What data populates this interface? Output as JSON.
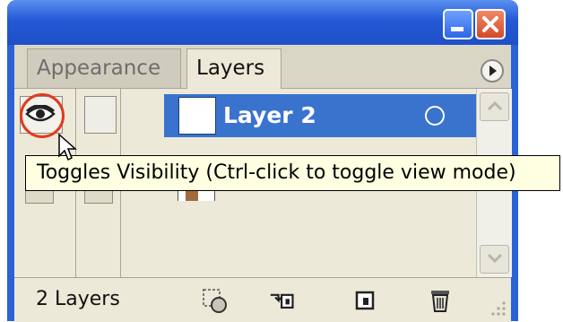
{
  "tabs": [
    {
      "label": "Appearance",
      "active": false
    },
    {
      "label": "Layers",
      "active": true
    }
  ],
  "layers": [
    {
      "name": "Layer 2",
      "selected": true,
      "visible": true
    }
  ],
  "tooltip": {
    "text": "Toggles Visibility (Ctrl-click to toggle view mode)"
  },
  "footer": {
    "layer_count": "2 Layers"
  },
  "icons": {
    "minimize": "minimize-icon",
    "close": "close-icon",
    "panel_menu": "panel-menu-icon",
    "visibility": "eye-icon",
    "make_clipping_mask": "clipping-mask-icon",
    "create_sublayer": "create-sublayer-icon",
    "create_layer": "create-layer-icon",
    "delete": "trash-icon"
  },
  "colors": {
    "selection": "#3a73cd",
    "titlebar": "#2459d6",
    "highlight_ring": "#e23a1d",
    "tooltip_bg": "#ffffe1",
    "panel_bg": "#ece9d8"
  }
}
